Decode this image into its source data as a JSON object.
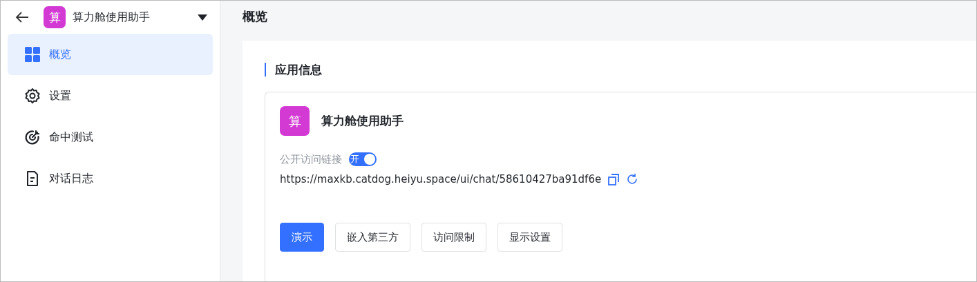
{
  "app": {
    "avatar": "算",
    "name": "算力舱使用助手"
  },
  "sidebar": {
    "items": [
      {
        "label": "概览",
        "selected": true
      },
      {
        "label": "设置",
        "selected": false
      },
      {
        "label": "命中测试",
        "selected": false
      },
      {
        "label": "对话日志",
        "selected": false
      }
    ]
  },
  "page_title": "概览",
  "section_title": "应用信息",
  "app_card": {
    "avatar": "算",
    "name": "算力舱使用助手",
    "public_link_label": "公开访问链接",
    "public_link": {
      "on": true,
      "label": "开"
    },
    "url": "https://maxkb.catdog.heiyu.space/ui/chat/58610427ba91df6e",
    "buttons": [
      {
        "label": "演示",
        "kind": "primary"
      },
      {
        "label": "嵌入第三方",
        "kind": "default"
      },
      {
        "label": "访问限制",
        "kind": "default"
      },
      {
        "label": "显示设置",
        "kind": "default"
      }
    ]
  }
}
